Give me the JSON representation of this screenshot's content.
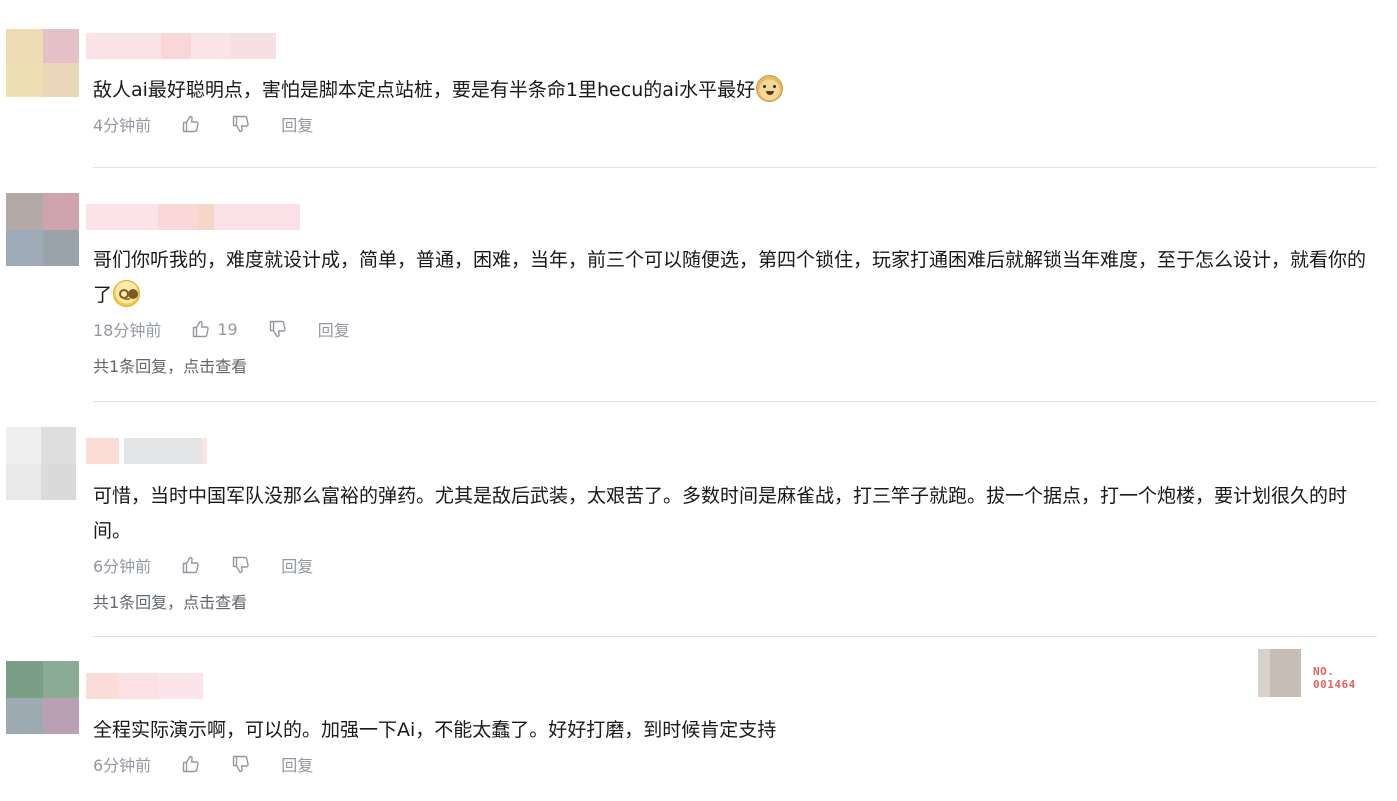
{
  "comments": [
    {
      "text": "敌人ai最好聪明点，害怕是脚本定点站桩，要是有半条命1里hecu的ai水平最好",
      "emoji": "doge-icon",
      "time": "4分钟前",
      "likes": "",
      "reply_label": "回复",
      "more_replies": ""
    },
    {
      "text": "哥们你听我的，难度就设计成，简单，普通，困难，当年，前三个可以随便选，第四个锁住，玩家打通困难后就解锁当年难度，至于怎么设计，就看你的了",
      "emoji": "shy-face-icon",
      "time": "18分钟前",
      "likes": "19",
      "reply_label": "回复",
      "more_replies": "共1条回复，点击查看"
    },
    {
      "text": "可惜，当时中国军队没那么富裕的弹药。尤其是敌后武装，太艰苦了。多数时间是麻雀战，打三竿子就跑。拔一个据点，打一个炮楼，要计划很久的时间。",
      "emoji": "",
      "time": "6分钟前",
      "likes": "",
      "reply_label": "回复",
      "more_replies": "共1条回复，点击查看"
    },
    {
      "text": "全程实际演示啊，可以的。加强一下Ai，不能太蠢了。好好打磨，到时候肯定支持",
      "emoji": "",
      "time": "6分钟前",
      "likes": "",
      "reply_label": "回复",
      "more_replies": ""
    }
  ],
  "badge": {
    "line1": "NO.",
    "line2": "001464"
  },
  "colors": {
    "text": "#18191c",
    "meta": "#9499a0",
    "divider": "#e3e5e7",
    "badge": "#e0665e"
  }
}
